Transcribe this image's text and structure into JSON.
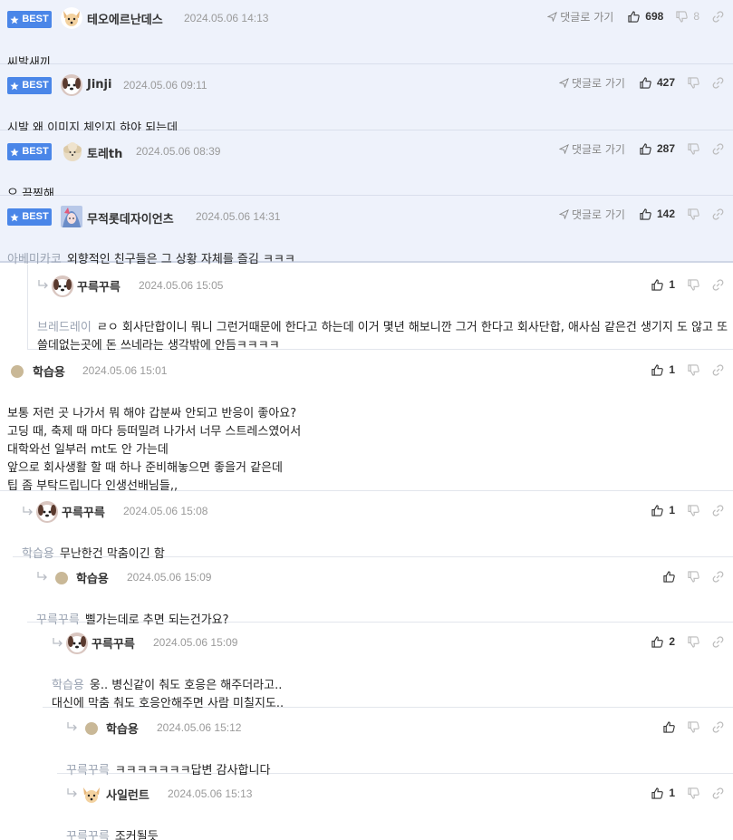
{
  "labels": {
    "best": "BEST",
    "goto_comment": "댓글로 가기"
  },
  "colors": {
    "best_bg": "#4a86e8",
    "best_row_bg": "#eef2fb",
    "mention": "#9aa3b2"
  },
  "comments": [
    {
      "id": "c1",
      "best": true,
      "nick": "테오에르난데스",
      "date": "2024.05.06 14:13",
      "avatar": "dog-face-avatar",
      "up": "698",
      "down": "8",
      "mention": "",
      "text": "씨발새끼"
    },
    {
      "id": "c2",
      "best": true,
      "nick": "Jinji",
      "date": "2024.05.06 09:11",
      "avatar": "puppy-avatar",
      "up": "427",
      "down": "",
      "mention": "",
      "text": "시발 왜 이미지 체인지 햐야 되는데"
    },
    {
      "id": "c3",
      "best": true,
      "nick": "토레th",
      "date": "2024.05.06 08:39",
      "avatar": "poodle-avatar",
      "up": "287",
      "down": "",
      "mention": "",
      "text": "으 끔찍해"
    },
    {
      "id": "c4",
      "best": true,
      "nick": "무적롯데자이언츠",
      "date": "2024.05.06 14:31",
      "avatar": "anime-avatar",
      "up": "142",
      "down": "",
      "mention": "아베미카코",
      "text": "외향적인 친구들은 그 상황 자체를 즐김 ㅋㅋㅋ"
    },
    {
      "id": "c5",
      "best": false,
      "nick": "꾸륵꾸륵",
      "date": "2024.05.06 15:05",
      "avatar": "puppy-avatar",
      "up": "1",
      "down": "",
      "mention": "브레드레이",
      "text": "ㄹㅇ 회사단합이니 뭐니 그런거때문에 한다고 하는데 이거 몇년 해보니깐 그거 한다고 회사단합, 애사심 같은건 생기지 도 않고 또 쓸데없는곳에 돈 쓰네라는 생각밖에 안듬ㅋㅋㅋㅋ"
    },
    {
      "id": "c6",
      "best": false,
      "nick": "학습용",
      "date": "2024.05.06 15:01",
      "avatar": "dot-avatar",
      "up": "1",
      "down": "",
      "mention": "",
      "text": "보통 저런 곳 나가서 뭐 해야 갑분싸 안되고 반응이 좋아요?\n고딩 때, 축제 때 마다 등떠밀려 나가서 너무 스트레스였어서\n대학와선 일부러 mt도 안 가는데\n앞으로 회사생활 할 때 하나 준비해놓으면 좋을거 같은데\n팁 좀 부탁드립니다 인생선배님들,,"
    },
    {
      "id": "c7",
      "best": false,
      "nick": "꾸륵꾸륵",
      "date": "2024.05.06 15:08",
      "avatar": "puppy-avatar",
      "up": "1",
      "down": "",
      "mention": "학습용",
      "text": "무난한건 막춤이긴 함"
    },
    {
      "id": "c8",
      "best": false,
      "nick": "학습용",
      "date": "2024.05.06 15:09",
      "avatar": "dot-avatar",
      "up": "",
      "down": "",
      "mention": "꾸륵꾸륵",
      "text": "삘가는데로 추면 되는건가요?"
    },
    {
      "id": "c9",
      "best": false,
      "nick": "꾸륵꾸륵",
      "date": "2024.05.06 15:09",
      "avatar": "puppy-avatar",
      "up": "2",
      "down": "",
      "mention": "학습용",
      "text": "웅.. 병신같이 춰도 호응은 해주더라고..\n대신에 막춤 춰도 호응안해주면 사람 미칠지도.."
    },
    {
      "id": "c10",
      "best": false,
      "nick": "학습용",
      "date": "2024.05.06 15:12",
      "avatar": "dot-avatar",
      "up": "",
      "down": "",
      "mention": "꾸륵꾸륵",
      "text": "ㅋㅋㅋㅋㅋㅋㅋ답변 감사합니다"
    },
    {
      "id": "c11",
      "best": false,
      "nick": "사일런트",
      "date": "2024.05.06 15:13",
      "avatar": "dog-face-avatar",
      "up": "1",
      "down": "",
      "mention": "꾸륵꾸륵",
      "text": "조커될듯"
    }
  ]
}
